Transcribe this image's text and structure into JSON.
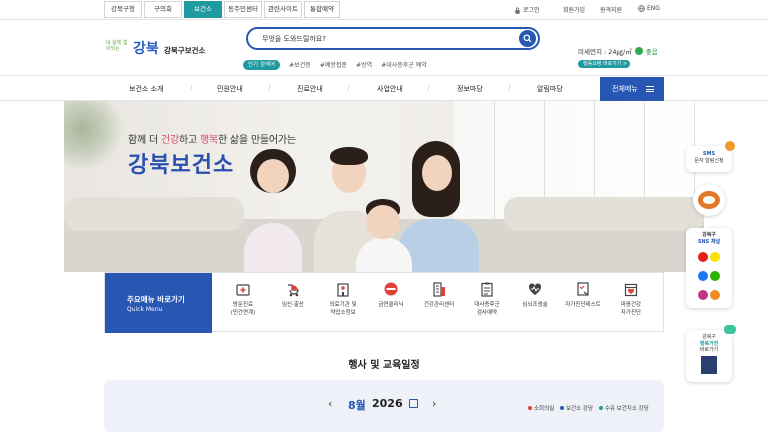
{
  "topbar": {
    "tabs": [
      "강북구청",
      "구의회",
      "보건소",
      "동주민센터",
      "관련사이트",
      "통합예약"
    ],
    "active_tab": "보건소",
    "links": {
      "login": "로그인",
      "join": "회원가입",
      "sitemap": "원격지원",
      "lang": "ENG"
    }
  },
  "header": {
    "logo": {
      "slogan": "내 삶에 힘이되는",
      "big": "강북",
      "name": "강북구보건소"
    },
    "search": {
      "placeholder": "무엇을 도와드릴까요?"
    },
    "popular": {
      "label": "인기 검색어",
      "keywords": [
        "#보건증",
        "#예방접종",
        "#방역",
        "#대사증후군 예약"
      ]
    },
    "dust": {
      "label": "미세먼지 : 24㎍/㎥",
      "status": "좋음",
      "button": "행동요령 바로가기 >"
    }
  },
  "gnb": {
    "items": [
      "보건소 소개",
      "민원안내",
      "진료안내",
      "사업안내",
      "정보마당",
      "알림마당"
    ],
    "all_menu": "전체메뉴"
  },
  "hero": {
    "tagline_parts": [
      "함께 더 ",
      "건강",
      "하고 ",
      "행복",
      "한 삶을 만들어가는"
    ],
    "title": "강북보건소"
  },
  "quick_menu": {
    "title": "주요메뉴 바로가기",
    "subtitle": "Quick Menu",
    "items": [
      {
        "line1": "방문진료",
        "line2": "(민간연계)"
      },
      {
        "line1": "임신·출산",
        "line2": ""
      },
      {
        "line1": "의료기관 및",
        "line2": "약업소정보"
      },
      {
        "line1": "금연클리닉",
        "line2": ""
      },
      {
        "line1": "건강관리센터",
        "line2": ""
      },
      {
        "line1": "대사증후군",
        "line2": "검사예약"
      },
      {
        "line1": "심뇌조생술",
        "line2": ""
      },
      {
        "line1": "자가진단테스트",
        "line2": ""
      },
      {
        "line1": "마음건강",
        "line2": "자가진단"
      }
    ]
  },
  "events": {
    "title": "행사 및 교육일정",
    "month": "8월",
    "year": "2026",
    "legend": [
      "소회의실",
      "보건소 강당",
      "수유 보건지소 강당"
    ],
    "legend_colors": [
      "#e0413a",
      "#2757b3",
      "#1e9aa0"
    ]
  },
  "side": {
    "sms": {
      "line1": "SMS",
      "line2": "문자 알림신청"
    },
    "sns": {
      "line1": "강북구",
      "line2": "SNS 채널"
    },
    "news": {
      "line1": "강북구",
      "line2": "행복거전",
      "line3": "바로가기"
    }
  },
  "colors": {
    "primary": "#2757b3",
    "teal": "#1e9aa0",
    "accent": "#d34f6b"
  }
}
